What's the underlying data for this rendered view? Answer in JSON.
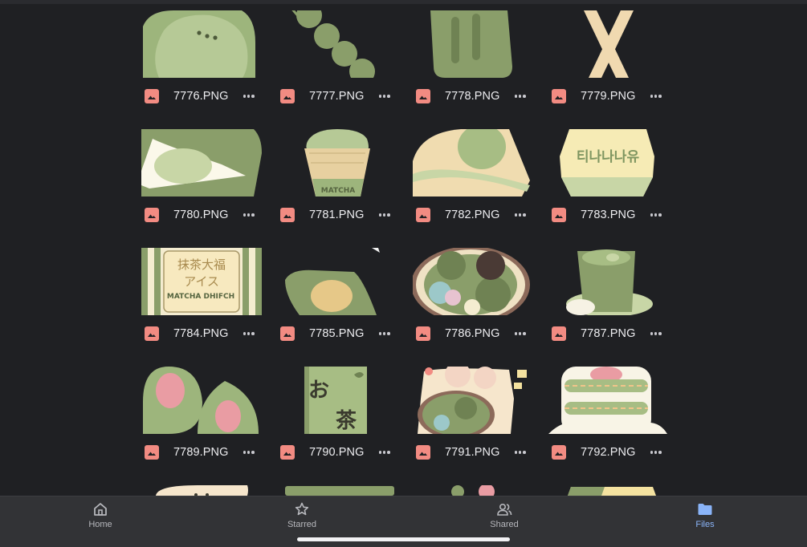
{
  "files": [
    {
      "name": "7776.PNG",
      "icon": "image-file-icon"
    },
    {
      "name": "7777.PNG",
      "icon": "image-file-icon"
    },
    {
      "name": "7778.PNG",
      "icon": "image-file-icon"
    },
    {
      "name": "7779.PNG",
      "icon": "image-file-icon"
    },
    {
      "name": "7780.PNG",
      "icon": "image-file-icon"
    },
    {
      "name": "7781.PNG",
      "icon": "image-file-icon"
    },
    {
      "name": "7782.PNG",
      "icon": "image-file-icon"
    },
    {
      "name": "7783.PNG",
      "icon": "image-file-icon"
    },
    {
      "name": "7784.PNG",
      "icon": "image-file-icon"
    },
    {
      "name": "7785.PNG",
      "icon": "image-file-icon"
    },
    {
      "name": "7786.PNG",
      "icon": "image-file-icon"
    },
    {
      "name": "7787.PNG",
      "icon": "image-file-icon"
    },
    {
      "name": "7789.PNG",
      "icon": "image-file-icon"
    },
    {
      "name": "7790.PNG",
      "icon": "image-file-icon"
    },
    {
      "name": "7791.PNG",
      "icon": "image-file-icon"
    },
    {
      "name": "7792.PNG",
      "icon": "image-file-icon"
    }
  ],
  "thumb_text": {
    "t7781": "MATCHA",
    "t7783": "티나나나유",
    "t7784_jp1": "抹茶大福",
    "t7784_jp2": "アイス",
    "t7784_en": "MATCHA DHIFCH",
    "t7790_a": "お",
    "t7790_b": "茶"
  },
  "nav": {
    "tabs": [
      {
        "label": "Home",
        "icon": "home-icon",
        "active": false
      },
      {
        "label": "Starred",
        "icon": "star-icon",
        "active": false
      },
      {
        "label": "Shared",
        "icon": "people-icon",
        "active": false
      },
      {
        "label": "Files",
        "icon": "folder-icon",
        "active": true
      }
    ]
  },
  "colors": {
    "background": "#1f2023",
    "tab_bar": "#323336",
    "accent": "#8ab4f8",
    "file_icon": "#f28b82",
    "matcha": "#a7bd84",
    "matcha_dark": "#8a9e6a",
    "cream": "#f4e6c6"
  }
}
